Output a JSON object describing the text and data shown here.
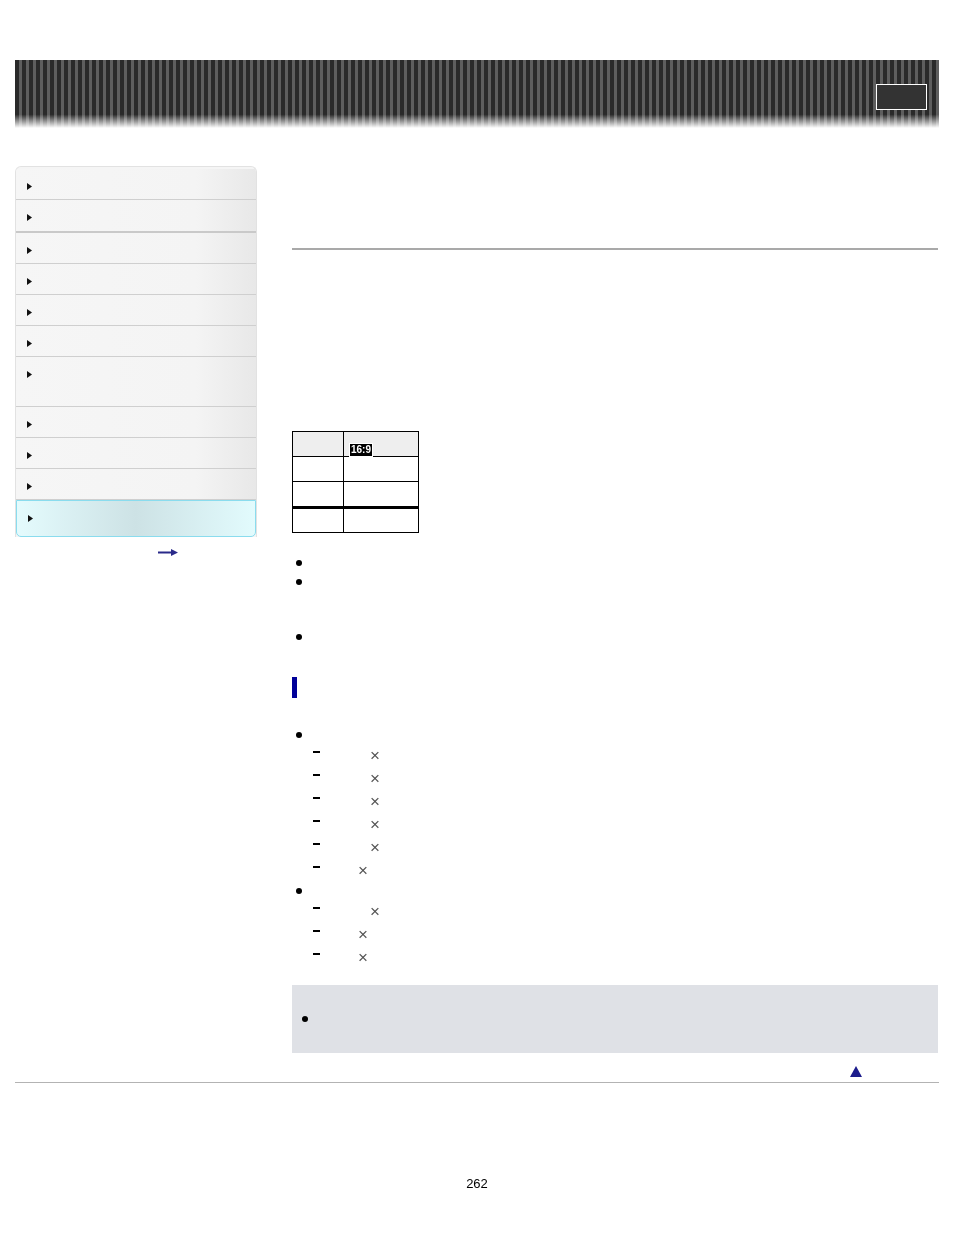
{
  "sidebar": {
    "sections": [
      {
        "items": [
          {
            "kind": "single",
            "selected": false
          },
          {
            "kind": "single",
            "selected": false
          }
        ]
      },
      {
        "items": [
          {
            "kind": "single",
            "selected": false
          },
          {
            "kind": "single",
            "selected": false
          },
          {
            "kind": "single",
            "selected": false
          },
          {
            "kind": "single",
            "selected": false
          },
          {
            "kind": "double",
            "selected": false
          },
          {
            "kind": "single",
            "selected": false
          },
          {
            "kind": "single",
            "selected": false
          },
          {
            "kind": "single",
            "selected": false
          },
          {
            "kind": "single",
            "selected": true
          }
        ]
      }
    ]
  },
  "table": {
    "header": {
      "column_2": "16:9"
    },
    "rows": [
      {
        "kind": "plain"
      },
      {
        "kind": "plain"
      },
      {
        "kind": "ruled"
      }
    ]
  },
  "notes": [
    {
      "kind": "single"
    },
    {
      "kind": "double"
    },
    {
      "kind": "single"
    }
  ],
  "section": {
    "bullets": [
      {
        "sub_items": [
          {
            "kind": "wide",
            "sign": "×"
          },
          {
            "kind": "wide",
            "sign": "×"
          },
          {
            "kind": "wide",
            "sign": "×"
          },
          {
            "kind": "wide",
            "sign": "×"
          },
          {
            "kind": "wide",
            "sign": "×"
          },
          {
            "kind": "narrow",
            "sign": "×"
          }
        ]
      },
      {
        "sub_items": [
          {
            "kind": "wide",
            "sign": "×"
          },
          {
            "kind": "narrow",
            "sign": "×"
          },
          {
            "kind": "narrow",
            "sign": "×"
          }
        ]
      }
    ]
  },
  "note_box": {
    "bullets": [
      {
        "kind": "single"
      }
    ]
  },
  "page_number": "262"
}
